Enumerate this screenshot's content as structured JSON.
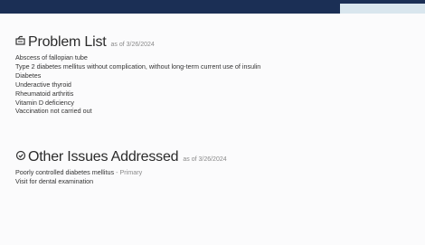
{
  "problem_list": {
    "icon": "problem-list-icon",
    "title": "Problem List",
    "as_of": "as of 3/26/2024",
    "items": [
      "Abscess of fallopian tube",
      "Type 2 diabetes mellitus without complication, without long-term current use of insulin",
      "Diabetes",
      "Underactive thyroid",
      "Rheumatoid arthritis",
      "Vitamin D deficiency",
      "Vaccination not carried out"
    ]
  },
  "other_issues": {
    "icon": "other-issues-icon",
    "title": "Other Issues Addressed",
    "as_of": "as of 3/26/2024",
    "items": [
      {
        "text": "Poorly controlled diabetes mellitus",
        "tag": "- Primary"
      },
      {
        "text": "Visit for dental examination",
        "tag": ""
      }
    ]
  }
}
